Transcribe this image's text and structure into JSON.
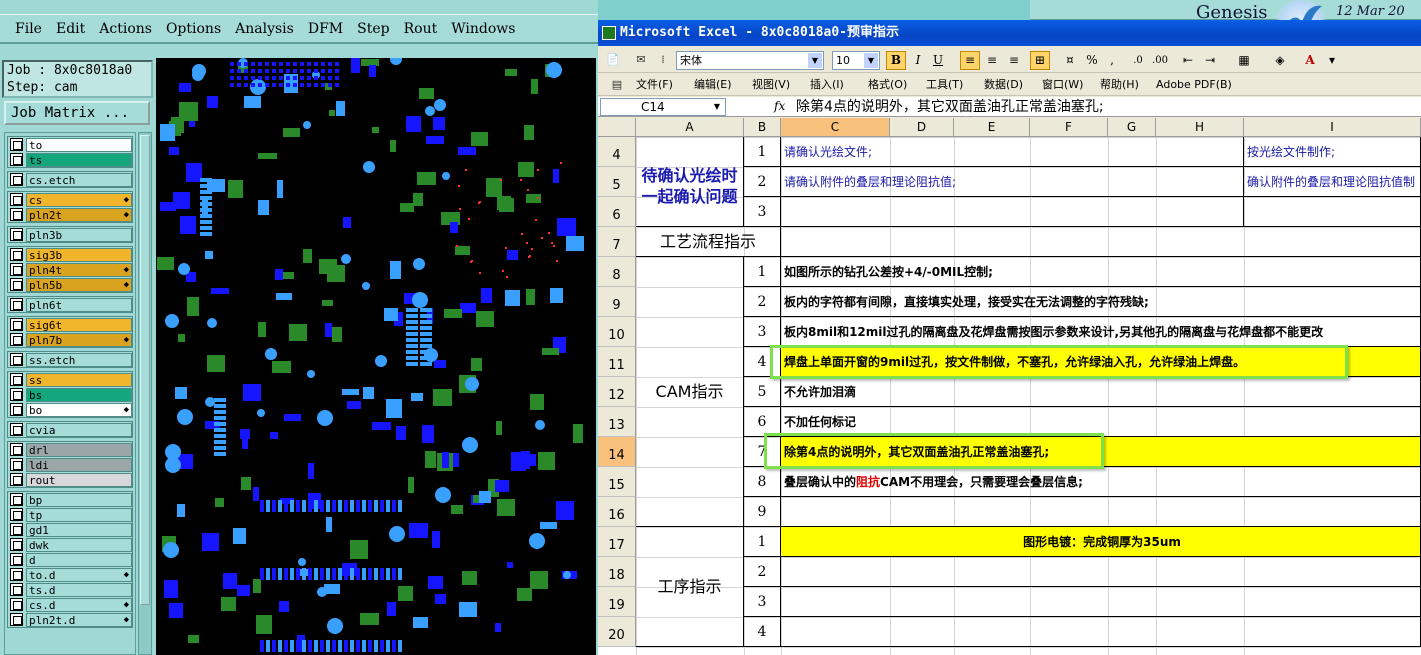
{
  "genesis": {
    "menu": [
      "File",
      "Edit",
      "Actions",
      "Options",
      "Analysis",
      "DFM",
      "Step",
      "Rout",
      "Windows"
    ],
    "job_line": "Job : 8x0c8018a0",
    "step_line": "Step: cam",
    "job_matrix_button": "Job Matrix ...",
    "layer_groups": [
      [
        {
          "name": "to",
          "color": "#ffffff",
          "arrow": ""
        },
        {
          "name": "ts",
          "color": "#14a77e",
          "arrow": ""
        }
      ],
      [
        {
          "name": "cs.etch",
          "color": "#a6dcd8",
          "arrow": ""
        }
      ],
      [
        {
          "name": "cs",
          "color": "#f0b52a",
          "arrow": "◆"
        },
        {
          "name": "pln2t",
          "color": "#d9a21f",
          "arrow": "◆"
        }
      ],
      [
        {
          "name": "pln3b",
          "color": "#a6dcd8",
          "arrow": ""
        }
      ],
      [
        {
          "name": "sig3b",
          "color": "#f0b52a",
          "arrow": ""
        },
        {
          "name": "pln4t",
          "color": "#d9a21f",
          "arrow": "◆"
        },
        {
          "name": "pln5b",
          "color": "#d9a21f",
          "arrow": "◆"
        }
      ],
      [
        {
          "name": "pln6t",
          "color": "#a6dcd8",
          "arrow": ""
        }
      ],
      [
        {
          "name": "sig6t",
          "color": "#f0b52a",
          "arrow": ""
        },
        {
          "name": "pln7b",
          "color": "#d9a21f",
          "arrow": "◆"
        }
      ],
      [
        {
          "name": "ss.etch",
          "color": "#a6dcd8",
          "arrow": ""
        }
      ],
      [
        {
          "name": "ss",
          "color": "#f0b52a",
          "arrow": ""
        },
        {
          "name": "bs",
          "color": "#14a77e",
          "arrow": ""
        },
        {
          "name": "bo",
          "color": "#ffffff",
          "arrow": "◆"
        }
      ],
      [
        {
          "name": "cvia",
          "color": "#a6dcd8",
          "arrow": ""
        }
      ],
      [
        {
          "name": "drl",
          "color": "#9aa6a8",
          "arrow": ""
        },
        {
          "name": "ldi",
          "color": "#9aa6a8",
          "arrow": ""
        },
        {
          "name": "rout",
          "color": "#d8d8d8",
          "arrow": ""
        }
      ],
      [
        {
          "name": "bp",
          "color": "#a6dcd8",
          "arrow": ""
        },
        {
          "name": "tp",
          "color": "#a6dcd8",
          "arrow": ""
        },
        {
          "name": "gd1",
          "color": "#a6dcd8",
          "arrow": ""
        },
        {
          "name": "dwk",
          "color": "#a6dcd8",
          "arrow": ""
        },
        {
          "name": "d",
          "color": "#a6dcd8",
          "arrow": ""
        },
        {
          "name": "to.d",
          "color": "#a6dcd8",
          "arrow": "◆"
        },
        {
          "name": "ts.d",
          "color": "#a6dcd8",
          "arrow": ""
        },
        {
          "name": "cs.d",
          "color": "#a6dcd8",
          "arrow": "◆"
        },
        {
          "name": "pln2t.d",
          "color": "#a6dcd8",
          "arrow": "◆"
        }
      ]
    ],
    "logo_text": "Genesis",
    "date_text": "12 Mar 20"
  },
  "excel": {
    "title": "Microsoft Excel - 8x0c8018a0-预审指示",
    "font_name": "宋体",
    "font_size": "10",
    "menu": [
      "文件(F)",
      "编辑(E)",
      "视图(V)",
      "插入(I)",
      "格式(O)",
      "工具(T)",
      "数据(D)",
      "窗口(W)",
      "帮助(H)",
      "Adobe PDF(B)"
    ],
    "name_box": "C14",
    "fx": "fx",
    "formula": "除第4点的说明外，其它双面盖油孔正常盖油塞孔;",
    "columns": [
      "A",
      "B",
      "C",
      "D",
      "E",
      "F",
      "G",
      "H",
      "I"
    ],
    "rows": [
      "4",
      "5",
      "6",
      "7",
      "8",
      "9",
      "10",
      "11",
      "12",
      "13",
      "14",
      "15",
      "16",
      "17",
      "18",
      "19",
      "20"
    ],
    "confirm_title": "待确认光绘时一起确认问题",
    "confirm_items": [
      {
        "n": "1",
        "c": "请确认光绘文件;",
        "i": "按光绘文件制作;"
      },
      {
        "n": "2",
        "c": "请确认附件的叠层和理论阻抗值;",
        "i": "确认附件的叠层和理论阻抗值制"
      },
      {
        "n": "3",
        "c": "",
        "i": ""
      }
    ],
    "process_title": "工艺流程指示",
    "cam_title": "CAM指示",
    "cam_items": [
      {
        "n": "1",
        "t": "如图所示的钻孔公差按+4/-0MIL控制;",
        "y": false
      },
      {
        "n": "2",
        "t": "板内的字符都有间隙，直接填实处理，接受实在无法调整的字符残缺;",
        "y": false
      },
      {
        "n": "3",
        "t": "板内8mil和12mil过孔的隔离盘及花焊盘需按图示参数来设计,另其他孔的隔离盘与花焊盘都不能更改",
        "y": false
      },
      {
        "n": "4",
        "t": "焊盘上单面开窗的9mil过孔，按文件制做，不塞孔，允许绿油入孔，允许绿油上焊盘。",
        "y": true
      },
      {
        "n": "5",
        "t": "不允许加泪滴",
        "y": false
      },
      {
        "n": "6",
        "t": "不加任何标记",
        "y": false
      },
      {
        "n": "7",
        "t": "除第4点的说明外，其它双面盖油孔正常盖油塞孔;",
        "y": true
      },
      {
        "n": "8",
        "t_pre": "叠层确认中的",
        "t_red": "阻抗",
        "t_post": "CAM不用理会，只需要理会叠层信息;",
        "y": false
      },
      {
        "n": "9",
        "t": "",
        "y": false
      }
    ],
    "proc_title": "工序指示",
    "proc_items": [
      {
        "n": "1",
        "t": "图形电镀：完成铜厚为35um",
        "y": true
      },
      {
        "n": "2",
        "t": "",
        "y": false
      },
      {
        "n": "3",
        "t": "",
        "y": false
      },
      {
        "n": "4",
        "t": "",
        "y": false
      }
    ]
  }
}
